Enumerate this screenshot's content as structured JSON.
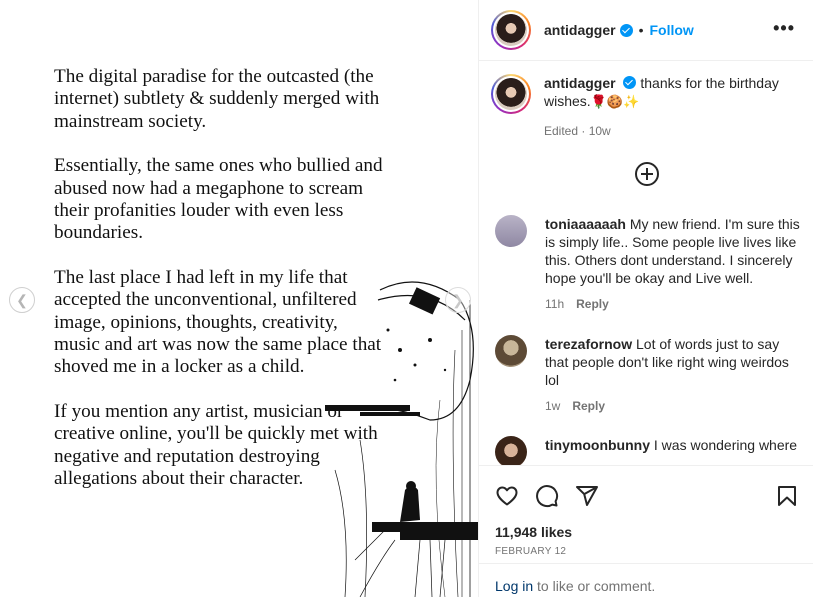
{
  "post_text": {
    "p1": "The digital paradise for the outcasted (the internet) subtlety & suddenly merged with mainstream society.",
    "p2": "Essentially, the same ones who bullied and abused now had a megaphone to scream their profanities louder with even less boundaries.",
    "p3": "The last place I had left in my life that accepted the unconventional, unfiltered image, opinions, thoughts, creativity, music and art was now the same place that shoved me in a locker as a child.",
    "p4": "If you mention any artist, musician or creative online, you'll be quickly met with negative and reputation destroying allegations about their character."
  },
  "carousel": {
    "prev_icon": "chevron-left-icon",
    "next_icon": "chevron-right-icon",
    "prev_glyph": "❮",
    "next_glyph": "❯"
  },
  "header": {
    "username": "antidagger",
    "separator": "•",
    "follow_label": "Follow",
    "more_glyph": "•••"
  },
  "caption": {
    "username": "antidagger",
    "text": "thanks for the birthday wishes.",
    "emojis": "🌹🍪✨",
    "meta": "Edited · 10w"
  },
  "comments": [
    {
      "username": "toniaaaaaah",
      "text": "My new friend. I'm sure this is simply life.. Some people live lives like this. Others dont understand. I sincerely hope you'll be okay and Live well.",
      "time": "11h",
      "reply": "Reply"
    },
    {
      "username": "terezafornow",
      "text": "Lot of words just to say that people don't like right wing weirdos lol",
      "time": "1w",
      "reply": "Reply"
    },
    {
      "username": "tinymoonbunny",
      "text": "I was wondering where",
      "time": "",
      "reply": ""
    }
  ],
  "footer": {
    "likes": "11,948 likes",
    "date": "FEBRUARY 12",
    "login_link": "Log in",
    "login_rest": " to like or comment."
  },
  "colors": {
    "accent": "#0095f6",
    "muted": "#737373",
    "text": "#262626",
    "link": "#00376b"
  }
}
